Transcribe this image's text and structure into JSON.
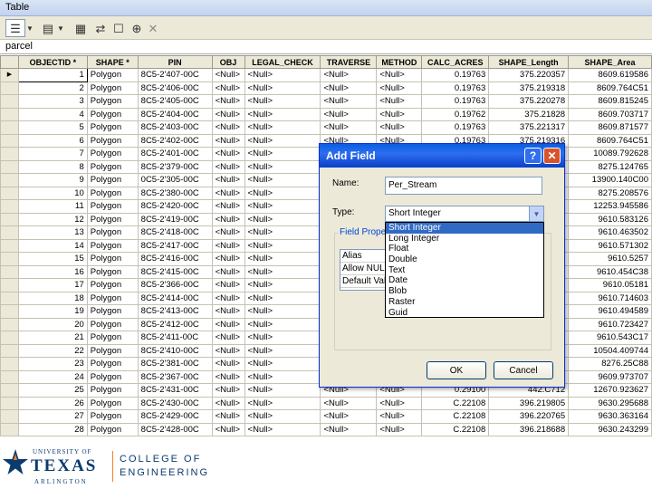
{
  "window": {
    "title": "Table"
  },
  "toolbar": {
    "buttons": [
      "table-options",
      "dropdown",
      "related-tables",
      "dropdown",
      "select-by-attributes",
      "switch-selection",
      "clear-selection",
      "zoom-to-selected",
      "delete-selected"
    ]
  },
  "layer": {
    "name": "parcel"
  },
  "table": {
    "columns": [
      "OBJECTID *",
      "SHAPE *",
      "PIN",
      "OBJ",
      "LEGAL_CHECK",
      "TRAVERSE",
      "METHOD",
      "CALC_ACRES",
      "SHAPE_Length",
      "SHAPE_Area"
    ],
    "rows": [
      [
        "1",
        "Polygon",
        "8C5-2'407-00C",
        "<Null>",
        "<Null>",
        "<Null>",
        "<Null>",
        "0.19763",
        "375.220357",
        "8609.619586"
      ],
      [
        "2",
        "Polygon",
        "8C5-2'406-00C",
        "<Null>",
        "<Null>",
        "<Null>",
        "<Null>",
        "0.19763",
        "375.219318",
        "8609.764C51"
      ],
      [
        "3",
        "Polygon",
        "8C5-2'405-00C",
        "<Null>",
        "<Null>",
        "<Null>",
        "<Null>",
        "0.19763",
        "375.220278",
        "8609.815245"
      ],
      [
        "4",
        "Polygon",
        "8C5-2'404-00C",
        "<Null>",
        "<Null>",
        "<Null>",
        "<Null>",
        "0.19762",
        "375.21828",
        "8609.703717"
      ],
      [
        "5",
        "Polygon",
        "8C5-2'403-00C",
        "<Null>",
        "<Null>",
        "<Null>",
        "<Null>",
        "0.19763",
        "375.221317",
        "8609.871577"
      ],
      [
        "6",
        "Polygon",
        "8C5-2'402-00C",
        "<Null>",
        "<Null>",
        "<Null>",
        "<Null>",
        "0.19763",
        "375.219316",
        "8609.764C51"
      ],
      [
        "7",
        "Polygon",
        "8C5-2'401-00C",
        "<Null>",
        "<Null>",
        "<Null>",
        "<Null>",
        "0.19763",
        "375.219316",
        "10089.792628"
      ],
      [
        "8",
        "Polygon",
        "8C5-2'379-00C",
        "<Null>",
        "<Null>",
        "<Null>",
        "<Null>",
        "0.19763",
        "375.219316",
        "8275.124765"
      ],
      [
        "9",
        "Polygon",
        "0C5-2'305-00C",
        "<Null>",
        "<Null>",
        "<Null>",
        "<Null>",
        "0.19763",
        "375.219316",
        "13900.140C00"
      ],
      [
        "10",
        "Polygon",
        "8C5-2'380-00C",
        "<Null>",
        "<Null>",
        "<Null>",
        "<Null>",
        "0.19763",
        "375.219316",
        "8275.208576"
      ],
      [
        "11",
        "Polygon",
        "8C5-2'420-00C",
        "<Null>",
        "<Null>",
        "<Null>",
        "<Null>",
        "0.19763",
        "375.219316",
        "12253.945586"
      ],
      [
        "12",
        "Polygon",
        "8C5-2'419-00C",
        "<Null>",
        "<Null>",
        "<Null>",
        "<Null>",
        "0.19763",
        "375.219316",
        "9610.583126"
      ],
      [
        "13",
        "Polygon",
        "8C5-2'418-00C",
        "<Null>",
        "<Null>",
        "<Null>",
        "<Null>",
        "0.19763",
        "375.219316",
        "9610.463502"
      ],
      [
        "14",
        "Polygon",
        "8C5-2'417-00C",
        "<Null>",
        "<Null>",
        "<Null>",
        "<Null>",
        "0.19763",
        "375.219316",
        "9610.571302"
      ],
      [
        "15",
        "Polygon",
        "8C5-2'416-00C",
        "<Null>",
        "<Null>",
        "<Null>",
        "<Null>",
        "0.19763",
        "375.219316",
        "9610.5257"
      ],
      [
        "16",
        "Polygon",
        "8C5-2'415-00C",
        "<Null>",
        "<Null>",
        "<Null>",
        "<Null>",
        "0.19763",
        "375.219316",
        "9610.454C38"
      ],
      [
        "17",
        "Polygon",
        "8C5-2'366-00C",
        "<Null>",
        "<Null>",
        "<Null>",
        "<Null>",
        "0.19763",
        "375.219316",
        "9610.05181"
      ],
      [
        "18",
        "Polygon",
        "8C5-2'414-00C",
        "<Null>",
        "<Null>",
        "<Null>",
        "<Null>",
        "0.19763",
        "375.219316",
        "9610.714603"
      ],
      [
        "19",
        "Polygon",
        "8C5-2'413-00C",
        "<Null>",
        "<Null>",
        "<Null>",
        "<Null>",
        "0.19763",
        "375.219316",
        "9610.494589"
      ],
      [
        "20",
        "Polygon",
        "8C5-2'412-00C",
        "<Null>",
        "<Null>",
        "<Null>",
        "<Null>",
        "0.19763",
        "375.219316",
        "9610.723427"
      ],
      [
        "21",
        "Polygon",
        "8C5-2'411-00C",
        "<Null>",
        "<Null>",
        "<Null>",
        "<Null>",
        "0.19763",
        "375.219316",
        "9610.543C17"
      ],
      [
        "22",
        "Polygon",
        "8C5-2'410-00C",
        "<Null>",
        "<Null>",
        "<Null>",
        "<Null>",
        "0.19763",
        "375.219316",
        "10504.409744"
      ],
      [
        "23",
        "Polygon",
        "8C5-2'381-00C",
        "<Null>",
        "<Null>",
        "<Null>",
        "<Null>",
        "0.19763",
        "375.219316",
        "8276.25C88"
      ],
      [
        "24",
        "Polygon",
        "8C5-2'367-00C",
        "<Null>",
        "<Null>",
        "<Null>",
        "<Null>",
        "0.19763",
        "375.219316",
        "9609.973707"
      ],
      [
        "25",
        "Polygon",
        "8C5-2'431-00C",
        "<Null>",
        "<Null>",
        "<Null>",
        "<Null>",
        "0.29100",
        "442.C712",
        "12670.923627"
      ],
      [
        "26",
        "Polygon",
        "8C5-2'430-00C",
        "<Null>",
        "<Null>",
        "<Null>",
        "<Null>",
        "C.22108",
        "396.219805",
        "9630.295688"
      ],
      [
        "27",
        "Polygon",
        "8C5-2'429-00C",
        "<Null>",
        "<Null>",
        "<Null>",
        "<Null>",
        "C.22108",
        "396.220765",
        "9630.363164"
      ],
      [
        "28",
        "Polygon",
        "8C5-2'428-00C",
        "<Null>",
        "<Null>",
        "<Null>",
        "<Null>",
        "C.22108",
        "396.218688",
        "9630.243299"
      ]
    ]
  },
  "dialog": {
    "title": "Add Field",
    "help": "?",
    "close": "✕",
    "name_label": "Name:",
    "name_value": "Per_Stream",
    "type_label": "Type:",
    "type_value": "Short Integer",
    "group_label": "Field Properties",
    "properties": [
      "Alias",
      "Allow NULL Values",
      "Default Value"
    ],
    "type_options": [
      "Short Integer",
      "Long Integer",
      "Float",
      "Double",
      "Text",
      "Date",
      "Blob",
      "Raster",
      "Guid"
    ],
    "ok": "OK",
    "cancel": "Cancel"
  },
  "footer": {
    "uni_small": "UNIVERSITY OF",
    "uni_big": "TEXAS",
    "uni_city": "ARLINGTON",
    "college_line1": "COLLEGE OF",
    "college_line2": "ENGINEERING",
    "brand_blue": "#0b3b6e",
    "brand_orange": "#f58025"
  }
}
